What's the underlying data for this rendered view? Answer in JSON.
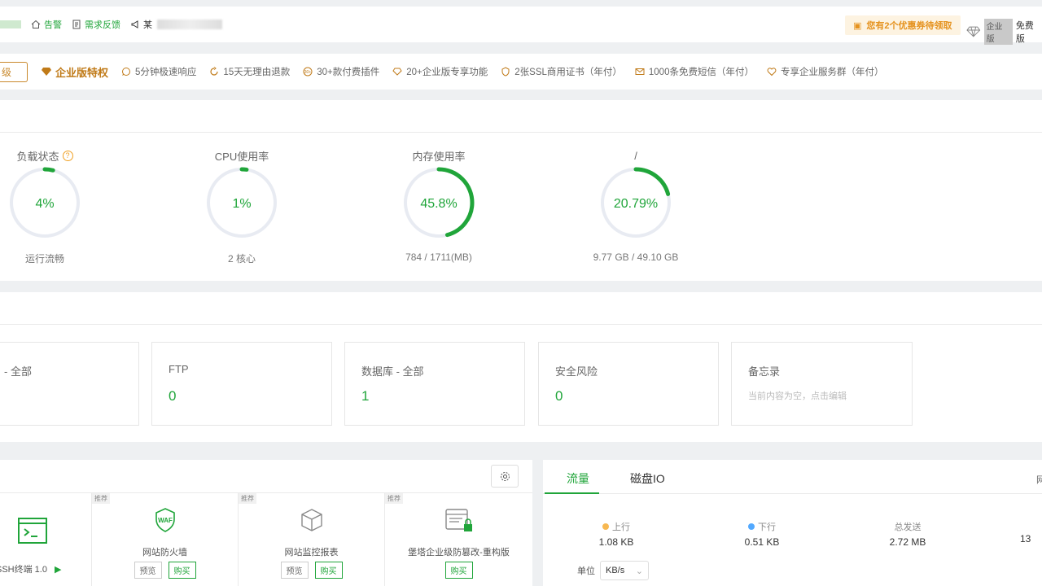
{
  "topbar": {
    "alarm_label": "告警",
    "feedback_label": "需求反馈",
    "notice_prefix": "某",
    "coupon_text": "您有2个优惠券待领取",
    "edition_label": "企业版",
    "free_label": "免费版"
  },
  "privileges": {
    "upgrade_label": "级",
    "title": "企业版特权",
    "items": [
      {
        "label": "5分钟极速响应",
        "icon": "headset-icon"
      },
      {
        "label": "15天无理由退款",
        "icon": "refund-icon"
      },
      {
        "label": "30+款付费插件",
        "icon": "plugin-icon"
      },
      {
        "label": "20+企业版专享功能",
        "icon": "diamond-icon"
      },
      {
        "label": "2张SSL商用证书（年付）",
        "icon": "ssl-icon"
      },
      {
        "label": "1000条免费短信（年付）",
        "icon": "mail-icon"
      },
      {
        "label": "专享企业服务群（年付）",
        "icon": "heart-group-icon"
      }
    ]
  },
  "status": {
    "colors": {
      "accent": "#20a53a",
      "track": "#e8ebf2"
    },
    "gauges": [
      {
        "title": "负载状态",
        "value_text": "4%",
        "percent": 4,
        "sub": "运行流畅",
        "help": "?"
      },
      {
        "title": "CPU使用率",
        "value_text": "1%",
        "percent": 1,
        "sub": "2 核心"
      },
      {
        "title": "内存使用率",
        "value_text": "45.8%",
        "percent": 45.8,
        "sub": "784 / 1711(MB)"
      },
      {
        "title": "/",
        "value_text": "20.79%",
        "percent": 20.79,
        "sub": "9.77 GB / 49.10 GB"
      }
    ]
  },
  "overview": {
    "cards": [
      {
        "title": "- 全部",
        "value": ""
      },
      {
        "title": "FTP",
        "value": "0"
      },
      {
        "title": "数据库 - 全部",
        "value": "1"
      },
      {
        "title": "安全风险",
        "value": "0"
      },
      {
        "title": "备忘录",
        "note": "当前内容为空，点击编辑"
      }
    ]
  },
  "software": {
    "items": [
      {
        "name": "SSH终端 1.0",
        "tag": ""
      },
      {
        "name": "网站防火墙",
        "tag": "推荐",
        "preview": "预览",
        "buy": "购买"
      },
      {
        "name": "网站监控报表",
        "tag": "推荐",
        "preview": "预览",
        "buy": "购买"
      },
      {
        "name": "堡塔企业级防篡改-重构版",
        "tag": "推荐",
        "buy": "购买"
      }
    ]
  },
  "traffic": {
    "tabs": [
      "流量",
      "磁盘IO"
    ],
    "right_char": "网",
    "stats": [
      {
        "label": "上行",
        "value": "1.08 KB",
        "color": "#f7b851"
      },
      {
        "label": "下行",
        "value": "0.51 KB",
        "color": "#52a9ff"
      },
      {
        "label": "总发送",
        "value": "2.72 MB"
      },
      {
        "label": "",
        "value": "13"
      }
    ],
    "unit_label": "单位",
    "unit_value": "KB/s"
  }
}
